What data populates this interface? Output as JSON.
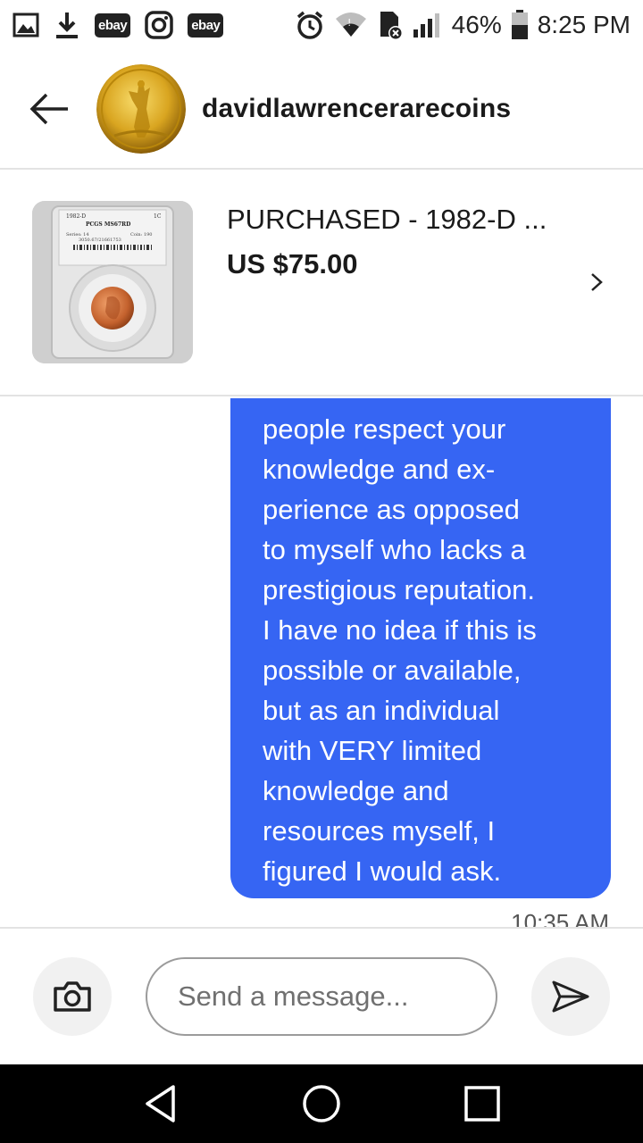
{
  "status_bar": {
    "icons_left": [
      "image-icon",
      "download-icon",
      "ebay-app-icon",
      "instagram-icon",
      "ebay-app-icon"
    ],
    "ebay_label": "ebay",
    "battery": "46%",
    "time": "8:25 PM"
  },
  "header": {
    "back_icon": "arrow-left-icon",
    "seller_name": "davidlawrencerarecoins"
  },
  "item": {
    "title": "PURCHASED - 1982-D ...",
    "price": "US $75.00",
    "slab_year": "1982-D",
    "slab_denom": "1C",
    "slab_grade": "PCGS MS67RD",
    "slab_series": "Series: 14",
    "slab_coin": "Coin: 190",
    "slab_cert": "3050.67/21661753"
  },
  "message": {
    "text": "people respect your\nknowledge and ex-\nperience as opposed\nto myself who lacks a\nprestigious reputation.\nI have no idea if this is\npossible or available,\nbut as an individual\nwith VERY limited\nknowledge and\nresources myself, I\nfigured I would ask.",
    "time": "10:35 AM",
    "bubble_color": "#3665f3"
  },
  "composer": {
    "placeholder": "Send a message...",
    "camera_icon": "camera-icon",
    "send_icon": "send-icon"
  },
  "nav": {
    "icons": [
      "back-triangle-icon",
      "home-circle-icon",
      "recents-square-icon"
    ]
  }
}
